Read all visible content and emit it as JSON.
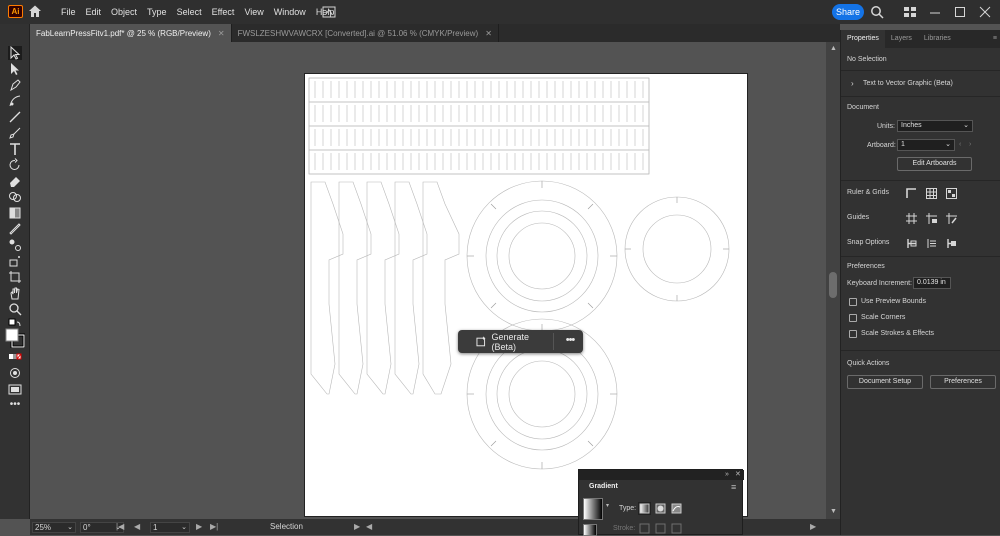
{
  "app": {
    "logo": "Ai"
  },
  "menu": [
    "File",
    "Edit",
    "Object",
    "Type",
    "Select",
    "Effect",
    "View",
    "Window",
    "Help"
  ],
  "share_label": "Share",
  "tabs": [
    {
      "label": "FabLearnPressFitv1.pdf* @ 25 % (RGB/Preview)",
      "active": true
    },
    {
      "label": "FWSLZESHWVAWCRX [Converted].ai @ 51.06 % (CMYK/Preview)",
      "active": false
    }
  ],
  "context_bar": {
    "generate_label": "Generate (Beta)",
    "more_label": "•••"
  },
  "status": {
    "zoom": "25%",
    "rotation": "0°",
    "artboard": "1",
    "mode": "Selection"
  },
  "properties": {
    "tabs": [
      "Properties",
      "Layers",
      "Libraries"
    ],
    "selection": "No Selection",
    "text_to_vector": "Text to Vector Graphic (Beta)",
    "document_title": "Document",
    "units_label": "Units:",
    "units_value": "Inches",
    "artboard_label": "Artboard:",
    "artboard_value": "1",
    "edit_artboards": "Edit Artboards",
    "rulers_grids": "Ruler & Grids",
    "guides": "Guides",
    "snap_options": "Snap Options",
    "preferences_title": "Preferences",
    "keyboard_increment_label": "Keyboard Increment:",
    "keyboard_increment_value": "0.0139 in",
    "use_preview_bounds": "Use Preview Bounds",
    "scale_corners": "Scale Corners",
    "scale_strokes": "Scale Strokes & Effects",
    "quick_actions": "Quick Actions",
    "document_setup": "Document Setup",
    "preferences_button": "Preferences"
  },
  "gradient_panel": {
    "title": "Gradient",
    "type_label": "Type:",
    "stroke_label": "Stroke:"
  },
  "colors": {
    "accent": "#1473e6",
    "panel": "#323232",
    "canvas": "#535353"
  }
}
